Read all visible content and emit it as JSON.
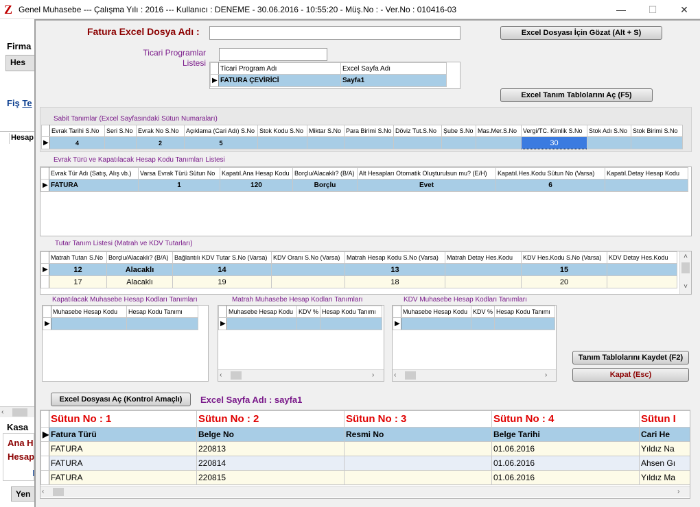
{
  "window": {
    "title": "Genel Muhasebe  ---  Çalışma Yılı : 2016   ---  Kullanıcı : DENEME - 30.06.2016 - 10:55:20 - Müş.No :  - Ver.No : 010416-03",
    "minimize": "—",
    "maximize": "☐",
    "close": "✕"
  },
  "background": {
    "firma_label": "Firma",
    "hes_button": "Hes",
    "fis_label": "Fiş",
    "fis_link": "Te",
    "hesap_col": "Hesap",
    "kasa_label": "Kasa",
    "ana_h": "Ana H",
    "hesap_label": "Hesap",
    "i_label": "I",
    "yen_button": "Yen"
  },
  "top": {
    "fatura_label": "Fatura Excel Dosya Adı :",
    "fatura_value": "",
    "browse_button": "Excel Dosyası İçin Gözat (Alt + S)",
    "ticari_label_1": "Ticari Programlar",
    "ticari_label_2": "Listesi",
    "ticari_value": "",
    "tanim_button": "Excel Tanım Tablolarını Aç (F5)",
    "program_grid": {
      "headers": [
        "Ticari Program Adı",
        "Excel Sayfa Adı"
      ],
      "rows": [
        [
          "FATURA ÇEVİRİCİ",
          "Sayfa1"
        ]
      ]
    }
  },
  "sabit": {
    "title": "Sabit Tanımlar (Excel Sayfasındaki Sütun Numaraları)",
    "headers": [
      "Evrak Tarihi S.No",
      "Seri S.No",
      "Evrak No S.No",
      "Açıklama (Cari Adı) S.No",
      "Stok Kodu S.No",
      "Miktar S.No",
      "Para Birimi S.No",
      "Döviz Tut.S.No",
      "Şube S.No",
      "Mas.Mer.S.No",
      "Vergi/TC. Kimlik S.No",
      "Stok Adı S.No",
      "Stok Birimi S.No"
    ],
    "row": [
      "4",
      "",
      "2",
      "5",
      "",
      "",
      "",
      "",
      "",
      "",
      "30",
      "",
      ""
    ]
  },
  "evrak": {
    "title": "Evrak Türü ve Kapatılacak Hesap Kodu Tanımları Listesi",
    "headers": [
      "Evrak Tür Adı (Satış, Alış vb.)",
      "Varsa Evrak Türü Sütun No",
      "Kapatıl.Ana Hesap Kodu",
      "Borçlu/Alacaklı? (B/A)",
      "Alt Hesapları Otomatik Oluşturulsun mu? (E/H)",
      "Kapatıl.Hes.Kodu Sütun No (Varsa)",
      "Kapatıl.Detay Hesap Kodu"
    ],
    "row": [
      "FATURA",
      "1",
      "120",
      "Borçlu",
      "Evet",
      "6",
      ""
    ]
  },
  "tutar": {
    "title": "Tutar Tanım Listesi (Matrah ve KDV Tutarları)",
    "headers": [
      "Matrah Tutarı S.No",
      "Borçlu/Alacaklı? (B/A)",
      "Bağlantılı KDV Tutar S.No (Varsa)",
      "KDV Oranı S.No (Varsa)",
      "Matrah Hesap Kodu S.No (Varsa)",
      "Matrah Detay Hes.Kodu",
      "KDV Hes.Kodu S.No (Varsa)",
      "KDV Detay Hes.Kodu"
    ],
    "rows": [
      [
        "12",
        "Alacaklı",
        "14",
        "",
        "13",
        "",
        "15",
        ""
      ],
      [
        "17",
        "Alacaklı",
        "19",
        "",
        "18",
        "",
        "20",
        ""
      ]
    ]
  },
  "kapat_panel": {
    "title": "Kapatılacak Muhasebe Hesap Kodları Tanımları",
    "headers": [
      "Muhasebe Hesap Kodu",
      "Hesap Kodu Tanımı"
    ]
  },
  "matrah_panel": {
    "title": "Matrah Muhasebe Hesap Kodları Tanımları",
    "headers": [
      "Muhasebe Hesap Kodu",
      "KDV %",
      "Hesap Kodu Tanımı"
    ]
  },
  "kdv_panel": {
    "title": "KDV Muhasebe Hesap Kodları Tanımları",
    "headers": [
      "Muhasebe Hesap Kodu",
      "KDV %",
      "Hesap Kodu Tanımı"
    ]
  },
  "buttons": {
    "kaydet": "Tanım Tablolarını Kaydet (F2)",
    "kapat": "Kapat (Esc)",
    "excel_ac": "Excel Dosyası Aç (Kontrol Amaçlı)"
  },
  "sheet": {
    "label": "Excel Sayfa Adı : sayfa1",
    "sutun": [
      "Sütun No : 1",
      "Sütun No : 2",
      "Sütun No : 3",
      "Sütun No : 4",
      "Sütun I"
    ],
    "headers": [
      "Fatura Türü",
      "Belge No",
      "Resmi No",
      "Belge Tarihi",
      "Cari He"
    ],
    "rows": [
      [
        "FATURA",
        "220813",
        "",
        "01.06.2016",
        "Yıldız Na"
      ],
      [
        "FATURA",
        "220814",
        "",
        "01.06.2016",
        "Ahsen Gı"
      ],
      [
        "FATURA",
        "220815",
        "",
        "01.06.2016",
        "Yıldız Ma"
      ]
    ]
  },
  "icons": {
    "row_indicator": "▶",
    "scroll_left": "‹",
    "scroll_right": "›",
    "scroll_up": "˄",
    "scroll_down": "˅"
  },
  "colors": {
    "selected_row": "#a8cde6",
    "highlight_cell": "#3b7be0",
    "title_maroon": "#8b0000",
    "section_purple": "#7a1a8a",
    "sutun_red": "#e00000"
  }
}
